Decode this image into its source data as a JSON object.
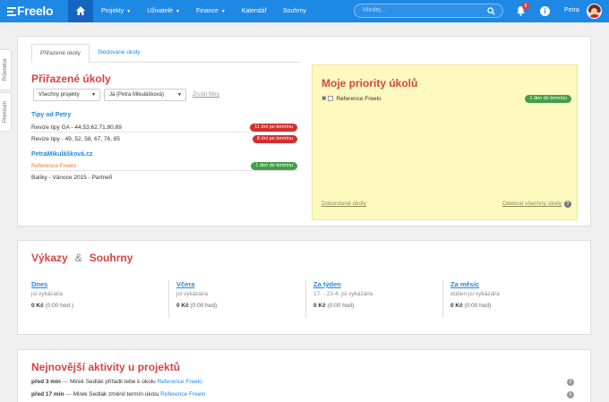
{
  "header": {
    "logo": "Freelo",
    "nav": [
      {
        "label": "Projekty",
        "dropdown": true
      },
      {
        "label": "Uživatelé",
        "dropdown": true
      },
      {
        "label": "Finance",
        "dropdown": true
      },
      {
        "label": "Kalendář",
        "dropdown": false
      },
      {
        "label": "Souhrny",
        "dropdown": false
      }
    ],
    "search_placeholder": "Hledej...",
    "notification_count": "8",
    "info_glyph": "i",
    "user_name": "Petra",
    "accent": "#1e88e5"
  },
  "side_tabs": {
    "guide": "Průvodce",
    "premium": "Premium"
  },
  "tasks_card": {
    "tabs": [
      "Přiřazené úkoly",
      "Sledované úkoly"
    ],
    "title": "Přiřazené úkoly",
    "filter_project": "Všechny projekty",
    "filter_user": "Já (Petra Mikulášková)",
    "reset_filters": "Zrušit filtry",
    "groups": [
      {
        "name": "Tipy od Petry",
        "tasks": [
          {
            "name": "Revize tipy GA - 44,53,62,71,80,89",
            "badge": "11 dní po termínu",
            "badge_color": "#d32f2f"
          },
          {
            "name": "Revize tipy - 49, 52, 58, 67, 76, 85",
            "badge": "8 dní po termínu",
            "badge_color": "#d32f2f"
          }
        ]
      },
      {
        "name": "PetraMikulášková.cz",
        "tasks": [
          {
            "name": "Reference Freelo",
            "badge": "1 den do termínu",
            "badge_color": "#43a047"
          },
          {
            "name": "Balíky - Vánoce 2015 - Partneři",
            "badge": "",
            "badge_color": ""
          }
        ]
      }
    ],
    "priorities": {
      "title": "Moje priority úkolů",
      "items": [
        {
          "name": "Reference Freelo",
          "badge": "1 den do termínu"
        }
      ],
      "done_link": "Dokončené úkoly",
      "remove_all_link": "Odebrat všechny úkoly",
      "help_glyph": "?",
      "background": "#fdf9bf"
    }
  },
  "reports_card": {
    "title_left": "Výkazy",
    "amp": "&",
    "title_right": "Souhrny",
    "stats": [
      {
        "label": "Dnes",
        "sub": "jsi vykázal/a",
        "amount": "0 Kč",
        "hours": "(0:00 hod )"
      },
      {
        "label": "Včera",
        "sub": "jsi vykázal/a",
        "amount": "0 Kč",
        "hours": "(0:00 hod)"
      },
      {
        "label": "Za týden",
        "sub": "17. - 23.4. jsi vykázal/a",
        "amount": "0 Kč",
        "hours": "(0:00 hod)"
      },
      {
        "label": "Za měsíc",
        "sub": "duben jsi vykázal/a",
        "amount": "0 Kč",
        "hours": "(0:00 hod)"
      }
    ]
  },
  "activity_card": {
    "title": "Nejnovější aktivity u projektů",
    "items": [
      {
        "time": "před 3 min",
        "dash": "—",
        "text": "Mirek Sedlák přiřadil tebe k úkolu",
        "link": "Reference Freelo"
      },
      {
        "time": "před 17 min",
        "dash": "—",
        "text": "Mirek Sedlák změnil termín úkolu",
        "link": "Reference Freelo"
      }
    ]
  }
}
